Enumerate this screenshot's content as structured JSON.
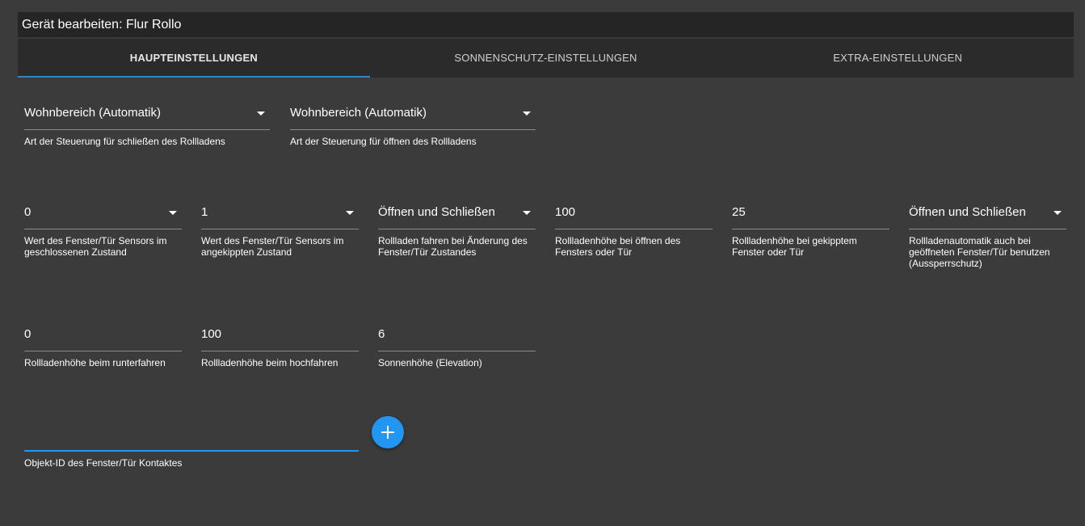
{
  "window": {
    "title": "Gerät bearbeiten: Flur Rollo"
  },
  "tabs": [
    {
      "label": "HAUPTEINSTELLUNGEN",
      "active": true
    },
    {
      "label": "SONNENSCHUTZ-EINSTELLUNGEN",
      "active": false
    },
    {
      "label": "EXTRA-EINSTELLUNGEN",
      "active": false
    }
  ],
  "fields": {
    "close_control": {
      "value": "Wohnbereich (Automatik)",
      "label": "Art der Steuerung für schließen des Rollladens"
    },
    "open_control": {
      "value": "Wohnbereich (Automatik)",
      "label": "Art der Steuerung für öffnen des Rollladens"
    },
    "sensor_closed": {
      "value": "0",
      "label": "Wert des Fenster/Tür Sensors im geschlossenen Zustand"
    },
    "sensor_tilted": {
      "value": "1",
      "label": "Wert des Fenster/Tür Sensors im angekippten Zustand"
    },
    "move_on_change": {
      "value": "Öffnen und Schließen",
      "label": "Rollladen fahren bei Änderung des Fenster/Tür Zustandes"
    },
    "height_open": {
      "value": "100",
      "label": "Rollladenhöhe bei öffnen des Fensters oder Tür"
    },
    "height_tilted": {
      "value": "25",
      "label": "Rollladenhöhe bei gekipptem Fenster oder Tür"
    },
    "lockout": {
      "value": "Öffnen und Schließen",
      "label": "Rollladenautomatik auch bei geöffneten Fenster/Tür benutzen (Aussperrschutz)"
    },
    "height_down": {
      "value": "0",
      "label": "Rollladenhöhe beim runterfahren"
    },
    "height_up": {
      "value": "100",
      "label": "Rollladenhöhe beim hochfahren"
    },
    "sun_elevation": {
      "value": "6",
      "label": "Sonnenhöhe (Elevation)"
    },
    "contact_object_id": {
      "value": "",
      "label": "Objekt-ID des Fenster/Tür Kontaktes"
    }
  },
  "add_button": {
    "icon": "plus-icon"
  },
  "colors": {
    "accent": "#2196f3",
    "background": "#3b3b3b",
    "tab_bar": "#2b2b2b",
    "title_bar": "#252525"
  }
}
